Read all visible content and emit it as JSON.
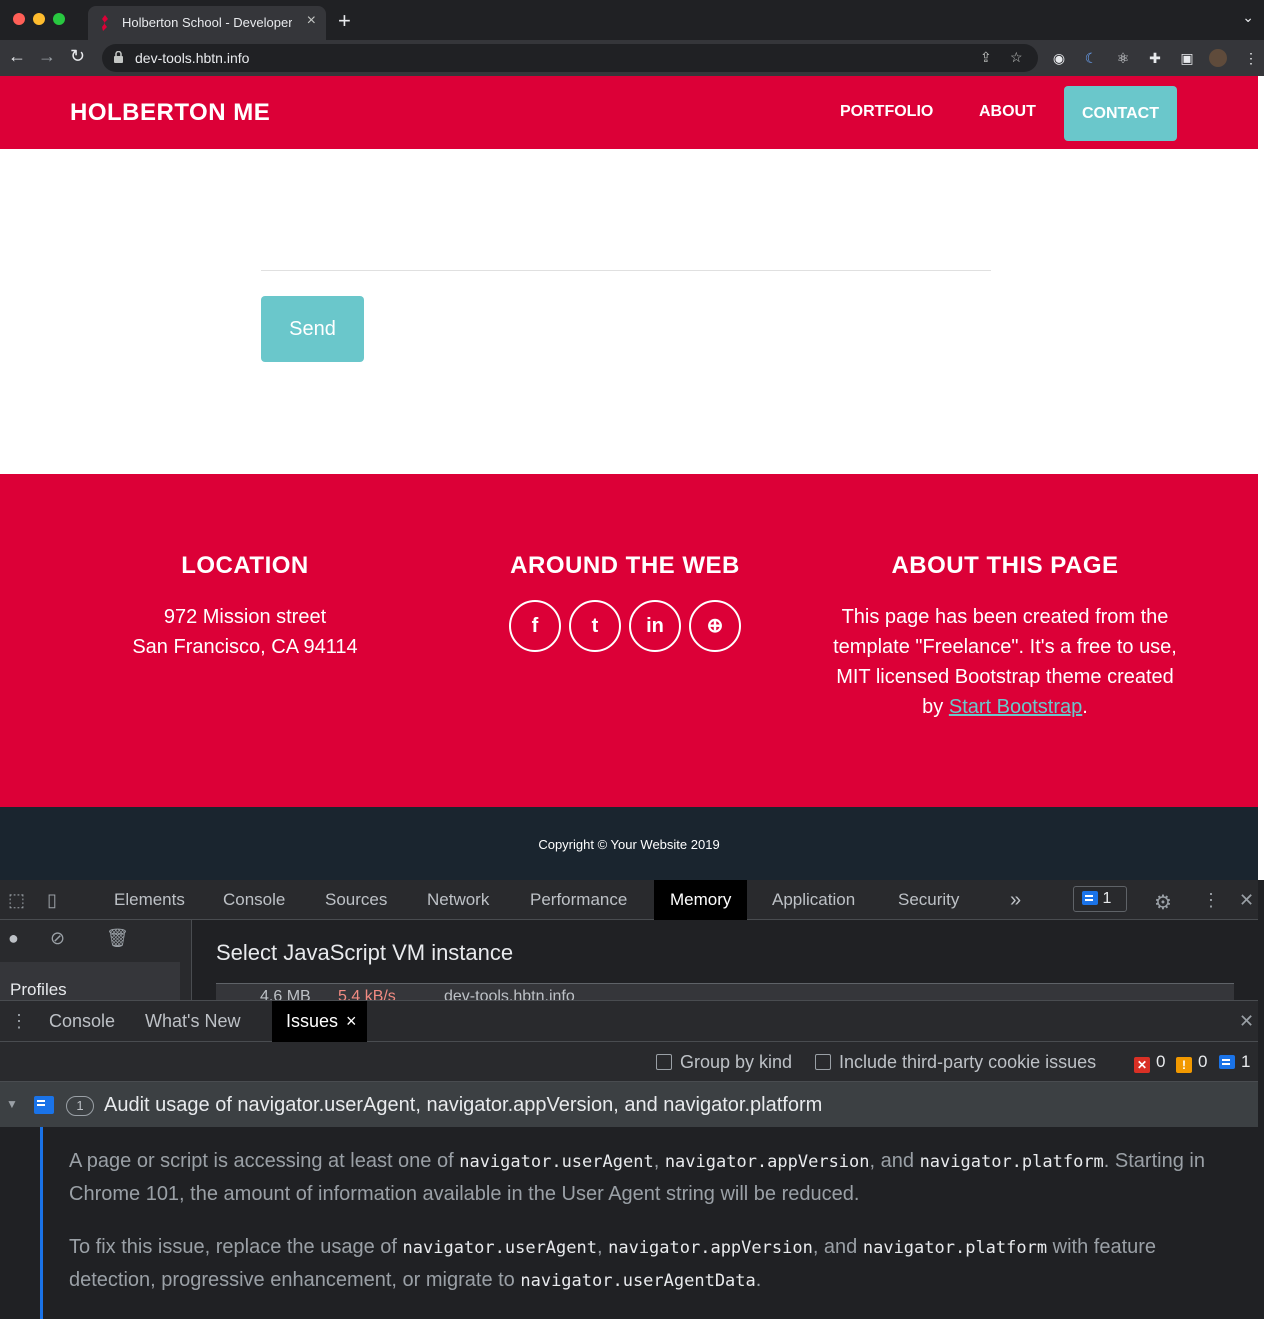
{
  "browser": {
    "tab_title": "Holberton School - Developer tools",
    "url": "dev-tools.hbtn.info",
    "tab_close": "×",
    "new_tab": "+"
  },
  "site": {
    "brand": "HOLBERTON ME",
    "nav": [
      "PORTFOLIO",
      "ABOUT",
      "CONTACT"
    ],
    "send_button": "Send",
    "footer": {
      "location_title": "LOCATION",
      "location_line1": "972 Mission street",
      "location_line2": "San Francisco, CA 94114",
      "web_title": "AROUND THE WEB",
      "social": [
        "f",
        "t",
        "in",
        "⊕"
      ],
      "about_title": "ABOUT THIS PAGE",
      "about_text": "This page has been created from the template \"Freelance\". It's a free to use, MIT licensed Bootstrap theme created by",
      "about_link": "Start Bootstrap",
      "about_end": "."
    },
    "copyright": "Copyright © Your Website 2019"
  },
  "devtools": {
    "tabs": [
      "Elements",
      "Console",
      "Sources",
      "Network",
      "Performance",
      "Memory",
      "Application",
      "Security"
    ],
    "more": "»",
    "issues_count": "1",
    "memory": {
      "select_vm": "Select JavaScript VM instance",
      "profiles": "Profiles",
      "vm_size": "4.6 MB",
      "vm_rate": "5.4 kB/s",
      "vm_name": "dev-tools.hbtn.info"
    },
    "drawer_tabs": [
      "Console",
      "What's New",
      "Issues"
    ],
    "drawer_close": "×",
    "issues_toolbar": {
      "group_by_kind": "Group by kind",
      "third_party": "Include third-party cookie issues",
      "errors": "0",
      "warnings": "0",
      "info": "1"
    },
    "issue": {
      "count": "1",
      "title": "Audit usage of navigator.userAgent, navigator.appVersion, and navigator.platform",
      "p1_a": "A page or script is accessing at least one of ",
      "code_ua": "navigator.userAgent",
      "sep_comma": ", ",
      "code_av": "navigator.appVersion",
      "sep_and": ", and ",
      "code_pf": "navigator.platform",
      "p1_b": ". Starting in Chrome 101, the amount of information available in the User Agent string will be reduced.",
      "p2_a": "To fix this issue, replace the usage of ",
      "p2_b": " with feature detection, progressive enhancement, or migrate to ",
      "code_uad": "navigator.userAgentData",
      "p2_end": "."
    }
  },
  "colors": {
    "brand_red": "#dc0037",
    "accent_teal": "#6ac7cb",
    "footer_dark": "#1a252f"
  }
}
